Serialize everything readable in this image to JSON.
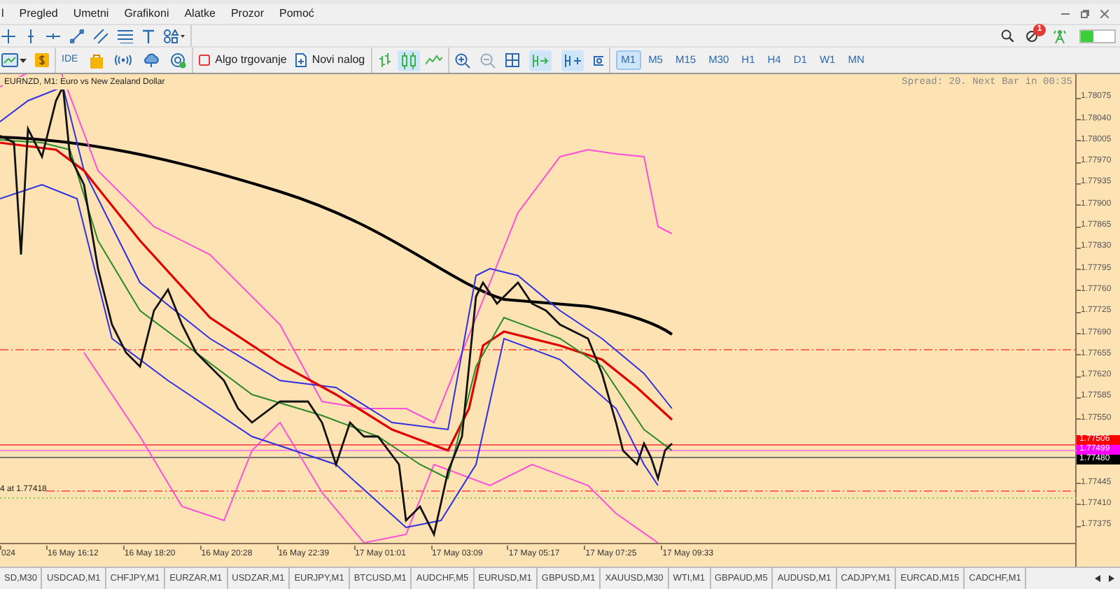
{
  "menu": [
    "l",
    "Pregled",
    "Umetni",
    "Grafikoni",
    "Alatke",
    "Prozor",
    "Pomoć"
  ],
  "toolbar": {
    "ide_label": "IDE",
    "buttons": [
      "Algo trgovanje",
      "Novi nalog"
    ]
  },
  "timeframes": [
    {
      "label": "M1",
      "selected": true
    },
    {
      "label": "M5",
      "selected": false
    },
    {
      "label": "M15",
      "selected": false
    },
    {
      "label": "M30",
      "selected": false
    },
    {
      "label": "H1",
      "selected": false
    },
    {
      "label": "H4",
      "selected": false
    },
    {
      "label": "D1",
      "selected": false
    },
    {
      "label": "W1",
      "selected": false
    },
    {
      "label": "MN",
      "selected": false
    }
  ],
  "notification_badge": "1",
  "chart": {
    "symbol_label": "EURNZD, M1:  Euro vs New Zealand Dollar",
    "info": "Spread: 20. Next Bar in 00:35",
    "line_label": "4 at 1.77418",
    "price_ticks_upper": [
      "1.78075",
      "1.78040",
      "1.78005",
      "1.77970",
      "1.77935",
      "1.77900",
      "1.77865",
      "1.77830",
      "1.77795",
      "1.77760",
      "1.77725",
      "1.77690",
      "1.77655",
      "1.77620",
      "1.77585",
      "1.77550"
    ],
    "price_ticks_lower": [
      "1.77445",
      "1.77410",
      "1.77375"
    ],
    "price_tags": [
      {
        "text": "1.77506",
        "color": "#ff0000"
      },
      {
        "text": "1.77499",
        "color": "#ff00ff"
      },
      {
        "text": "1.77480",
        "color": "#000000"
      }
    ],
    "time_ticks": [
      "024",
      "16 May 16:12",
      "16 May 18:20",
      "16 May 20:28",
      "16 May 22:39",
      "17 May 01:01",
      "17 May 03:09",
      "17 May 05:17",
      "17 May 07:25",
      "17 May 09:33"
    ]
  },
  "tabs": [
    "SD,M30",
    "USDCAD,M1",
    "CHFJPY,M1",
    "EURZAR,M1",
    "USDZAR,M1",
    "EURJPY,M1",
    "BTCUSD,M1",
    "AUDCHF,M5",
    "EURUSD,M1",
    "GBPUSD,M1",
    "XAUUSD,M30",
    "WTI,M1",
    "GBPAUD,M5",
    "AUDUSD,M1",
    "CADJPY,M1",
    "EURCAD,M15",
    "CADCHF,M1"
  ]
}
